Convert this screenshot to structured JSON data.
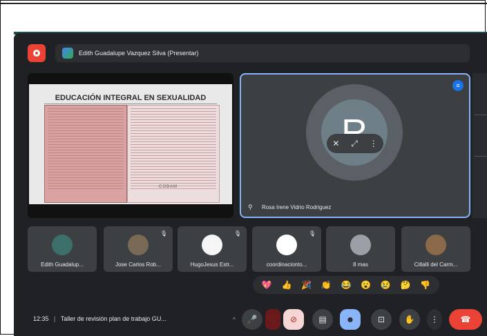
{
  "presentation_bar": {
    "presenter_label": "Edith Guadalupe Vazquez Silva (Presentar)"
  },
  "slide": {
    "title": "EDUCACIÓN INTEGRAL EN SEXUALIDAD",
    "logo_text": "COBAM"
  },
  "speaker": {
    "initial": "R",
    "name": "Rosa Irene Vidrio Rodriguez"
  },
  "participants": [
    {
      "name": "Edith Guadalup...",
      "muted": false,
      "avatar_color": "#3d6f6a"
    },
    {
      "name": "Jose Carlos Rob...",
      "muted": true,
      "avatar_color": "#7a6a55"
    },
    {
      "name": "HugoJesus Estr...",
      "muted": true,
      "avatar_color": "#f5f5f5"
    },
    {
      "name": "coordinacionto...",
      "muted": true,
      "avatar_color": "#ffffff"
    },
    {
      "name": "8 mas",
      "muted": false,
      "avatar_color": "#9aa0a6"
    },
    {
      "name": "Citlalli del Carm...",
      "muted": false,
      "avatar_color": "#8a6a4a"
    }
  ],
  "reactions": [
    "💖",
    "👍",
    "🎉",
    "👏",
    "😂",
    "😮",
    "😢",
    "🤔",
    "👎"
  ],
  "meeting": {
    "time": "12:35",
    "separator": "|",
    "title": "Taller de revisión plan de trabajo GU..."
  },
  "controls": {
    "chevron_up": "^",
    "mic": "🎤",
    "camera_off": "⊘",
    "captions": "▤",
    "emoji": "☻",
    "present": "⊡",
    "raise_hand": "✋",
    "more": "⋮",
    "hangup": "☎"
  },
  "colors": {
    "meet_bg": "#202124",
    "tile_bg": "#3c4043",
    "accent_blue": "#8ab4f8",
    "hangup_red": "#ea4335"
  }
}
